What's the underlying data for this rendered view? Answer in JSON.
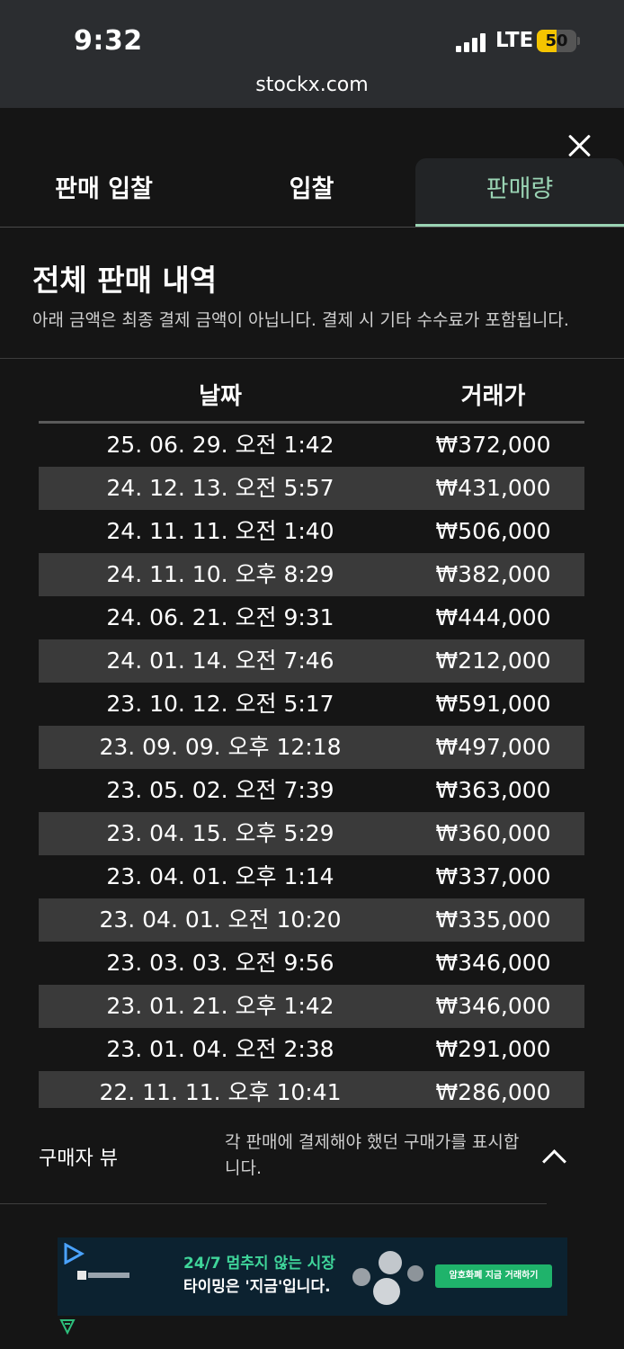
{
  "status_bar": {
    "time": "9:32",
    "network": "LTE",
    "battery": "50",
    "battery_level": 0.5
  },
  "browser": {
    "url": "stockx.com"
  },
  "tabs": [
    {
      "label": "판매 입찰",
      "active": false
    },
    {
      "label": "입찰",
      "active": false
    },
    {
      "label": "판매량",
      "active": true
    }
  ],
  "section": {
    "title": "전체 판매 내역",
    "description": "아래 금액은 최종 결제 금액이 아닙니다. 결제 시 기타 수수료가 포함됩니다."
  },
  "table": {
    "headers": {
      "date": "날짜",
      "price": "거래가"
    },
    "rows": [
      {
        "date": "25. 06. 29. 오전 1:42",
        "price": "₩372,000"
      },
      {
        "date": "24. 12. 13. 오전 5:57",
        "price": "₩431,000"
      },
      {
        "date": "24. 11. 11. 오전 1:40",
        "price": "₩506,000"
      },
      {
        "date": "24. 11. 10. 오후 8:29",
        "price": "₩382,000"
      },
      {
        "date": "24. 06. 21. 오전 9:31",
        "price": "₩444,000"
      },
      {
        "date": "24. 01. 14. 오전 7:46",
        "price": "₩212,000"
      },
      {
        "date": "23. 10. 12. 오전 5:17",
        "price": "₩591,000"
      },
      {
        "date": "23. 09. 09. 오후 12:18",
        "price": "₩497,000"
      },
      {
        "date": "23. 05. 02. 오전 7:39",
        "price": "₩363,000"
      },
      {
        "date": "23. 04. 15. 오후 5:29",
        "price": "₩360,000"
      },
      {
        "date": "23. 04. 01. 오후 1:14",
        "price": "₩337,000"
      },
      {
        "date": "23. 04. 01. 오전 10:20",
        "price": "₩335,000"
      },
      {
        "date": "23. 03. 03. 오전 9:56",
        "price": "₩346,000"
      },
      {
        "date": "23. 01. 21. 오후 1:42",
        "price": "₩346,000"
      },
      {
        "date": "23. 01. 04. 오전 2:38",
        "price": "₩291,000"
      },
      {
        "date": "22. 11. 11. 오후 10:41",
        "price": "₩286,000"
      }
    ]
  },
  "buyer_view": {
    "label": "구매자 뷰",
    "description": "각 판매에 결제해야 했던 구매가를 표시합니다."
  },
  "ad": {
    "line1": "24/7 멈추지 않는 시장",
    "line2": "타이밍은 '지금'입니다.",
    "cta": "암호화폐 지금 거래하기"
  },
  "colors": {
    "background": "#151515",
    "active_tab": "#9ad4b4",
    "alt_row": "#3a3a3a",
    "battery": "#f5c400"
  }
}
